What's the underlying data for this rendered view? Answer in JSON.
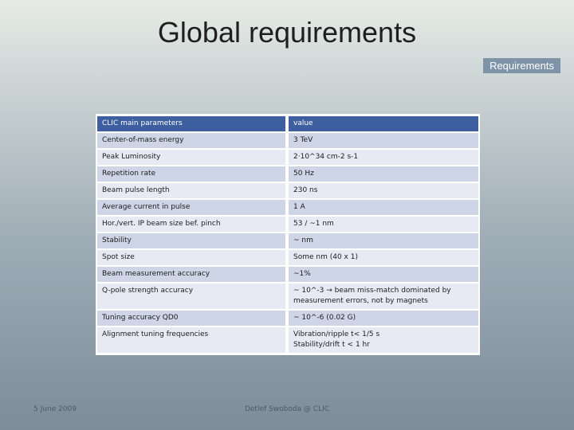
{
  "slide": {
    "title": "Global requirements",
    "section_tag": "Requirements",
    "footer_date": "5 June 2009",
    "footer_author": "Detlef Swoboda @ CLIC"
  },
  "table": {
    "header": [
      "CLIC main parameters",
      "value"
    ],
    "rows": [
      {
        "param": "Center-of-mass energy",
        "value": "3 TeV"
      },
      {
        "param": "Peak Luminosity",
        "value": "2·10^34 cm-2 s-1"
      },
      {
        "param": "Repetition rate",
        "value": "50 Hz"
      },
      {
        "param": "Beam pulse length",
        "value": "230 ns"
      },
      {
        "param": "Average current in pulse",
        "value": "1 A"
      },
      {
        "param": "Hor./vert. IP beam size bef. pinch",
        "value": "53 / ~1 nm"
      },
      {
        "param": "Stability",
        "value": "~ nm"
      },
      {
        "param": "Spot size",
        "value": "Some nm (40 x 1)"
      },
      {
        "param": "Beam measurement accuracy",
        "value": "~1%"
      },
      {
        "param": "Q-pole strength accuracy",
        "value": "~ 10^-3 → beam miss-match dominated by\nmeasurement errors, not by magnets"
      },
      {
        "param": "Tuning accuracy QD0",
        "value": "~ 10^-6 (0.02 G)"
      },
      {
        "param": "Alignment tuning frequencies",
        "value": "Vibration/ripple t< 1/5 s\nStability/drift    t < 1 hr"
      }
    ]
  }
}
